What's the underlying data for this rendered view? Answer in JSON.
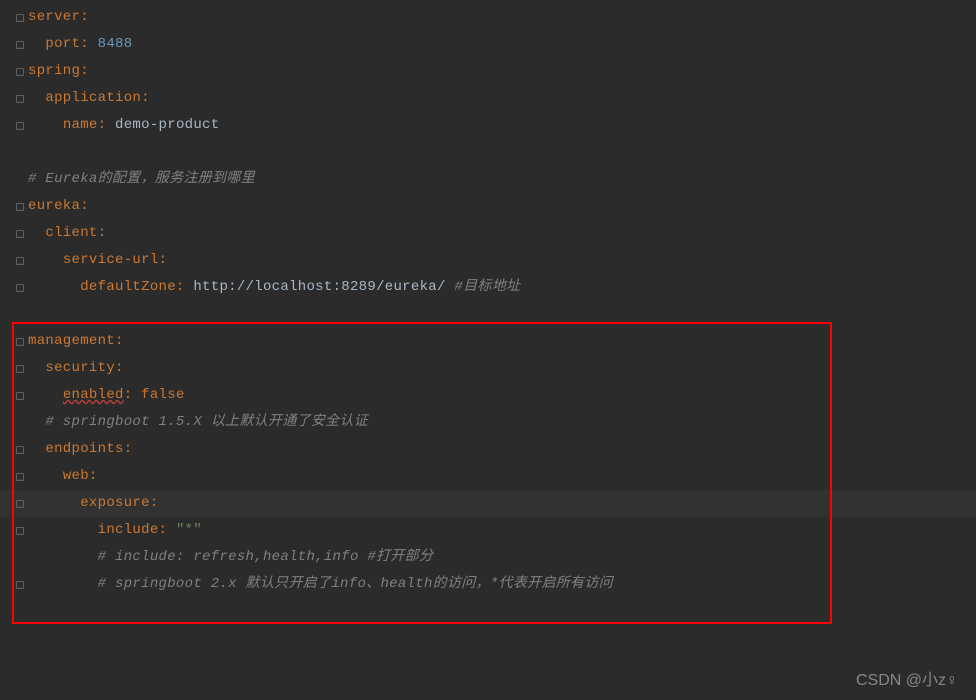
{
  "lines": [
    {
      "gutter": "fold",
      "tokens": [
        {
          "t": "server",
          "c": "key"
        },
        {
          "t": ":",
          "c": "key"
        }
      ]
    },
    {
      "gutter": "fold",
      "tokens": [
        {
          "t": "  ",
          "c": ""
        },
        {
          "t": "port",
          "c": "key"
        },
        {
          "t": ": ",
          "c": "key"
        },
        {
          "t": "8488",
          "c": "number"
        }
      ]
    },
    {
      "gutter": "fold",
      "tokens": [
        {
          "t": "spring",
          "c": "key"
        },
        {
          "t": ":",
          "c": "key"
        }
      ]
    },
    {
      "gutter": "fold",
      "tokens": [
        {
          "t": "  ",
          "c": ""
        },
        {
          "t": "application",
          "c": "key"
        },
        {
          "t": ":",
          "c": "key"
        }
      ]
    },
    {
      "gutter": "fold",
      "tokens": [
        {
          "t": "    ",
          "c": ""
        },
        {
          "t": "name",
          "c": "key"
        },
        {
          "t": ": ",
          "c": "key"
        },
        {
          "t": "demo-product",
          "c": "value"
        }
      ]
    },
    {
      "gutter": "",
      "tokens": []
    },
    {
      "gutter": "",
      "tokens": [
        {
          "t": "# Eureka的配置，服务注册到哪里",
          "c": "comment"
        }
      ]
    },
    {
      "gutter": "fold",
      "tokens": [
        {
          "t": "eureka",
          "c": "key"
        },
        {
          "t": ":",
          "c": "key"
        }
      ]
    },
    {
      "gutter": "fold",
      "tokens": [
        {
          "t": "  ",
          "c": ""
        },
        {
          "t": "client",
          "c": "key"
        },
        {
          "t": ":",
          "c": "key"
        }
      ]
    },
    {
      "gutter": "fold",
      "tokens": [
        {
          "t": "    ",
          "c": ""
        },
        {
          "t": "service-url",
          "c": "key"
        },
        {
          "t": ":",
          "c": "key"
        }
      ]
    },
    {
      "gutter": "fold",
      "tokens": [
        {
          "t": "      ",
          "c": ""
        },
        {
          "t": "defaultZone",
          "c": "key"
        },
        {
          "t": ": ",
          "c": "key"
        },
        {
          "t": "http://localhost:8289/eureka/ ",
          "c": "value"
        },
        {
          "t": "#目标地址",
          "c": "comment"
        }
      ]
    },
    {
      "gutter": "",
      "tokens": []
    },
    {
      "gutter": "fold",
      "tokens": [
        {
          "t": "management",
          "c": "key"
        },
        {
          "t": ":",
          "c": "key"
        }
      ]
    },
    {
      "gutter": "fold",
      "tokens": [
        {
          "t": "  ",
          "c": ""
        },
        {
          "t": "security",
          "c": "key"
        },
        {
          "t": ":",
          "c": "key"
        }
      ]
    },
    {
      "gutter": "fold",
      "tokens": [
        {
          "t": "    ",
          "c": ""
        },
        {
          "t": "enabled",
          "c": "key underline-wavy"
        },
        {
          "t": ": ",
          "c": "key"
        },
        {
          "t": "false",
          "c": "key"
        }
      ]
    },
    {
      "gutter": "",
      "tokens": [
        {
          "t": "  ",
          "c": ""
        },
        {
          "t": "# springboot 1.5.X 以上默认开通了安全认证",
          "c": "comment"
        }
      ]
    },
    {
      "gutter": "fold",
      "tokens": [
        {
          "t": "  ",
          "c": ""
        },
        {
          "t": "endpoints",
          "c": "key"
        },
        {
          "t": ":",
          "c": "key"
        }
      ]
    },
    {
      "gutter": "fold",
      "tokens": [
        {
          "t": "    ",
          "c": ""
        },
        {
          "t": "web",
          "c": "key"
        },
        {
          "t": ":",
          "c": "key"
        }
      ]
    },
    {
      "gutter": "fold",
      "tokens": [
        {
          "t": "      ",
          "c": ""
        },
        {
          "t": "exposure",
          "c": "key"
        },
        {
          "t": ":",
          "c": "key"
        }
      ],
      "highlight": true
    },
    {
      "gutter": "fold",
      "tokens": [
        {
          "t": "        ",
          "c": ""
        },
        {
          "t": "include",
          "c": "key"
        },
        {
          "t": ": ",
          "c": "key"
        },
        {
          "t": "\"*\"",
          "c": "string"
        }
      ]
    },
    {
      "gutter": "",
      "tokens": [
        {
          "t": "        ",
          "c": ""
        },
        {
          "t": "# include: refresh,health,info #打开部分",
          "c": "comment"
        }
      ]
    },
    {
      "gutter": "fold",
      "tokens": [
        {
          "t": "        ",
          "c": ""
        },
        {
          "t": "# springboot 2.x 默认只开启了info、health的访问，*代表开启所有访问",
          "c": "comment"
        }
      ]
    },
    {
      "gutter": "",
      "tokens": []
    },
    {
      "gutter": "",
      "tokens": []
    }
  ],
  "watermark": "CSDN @小z♀"
}
